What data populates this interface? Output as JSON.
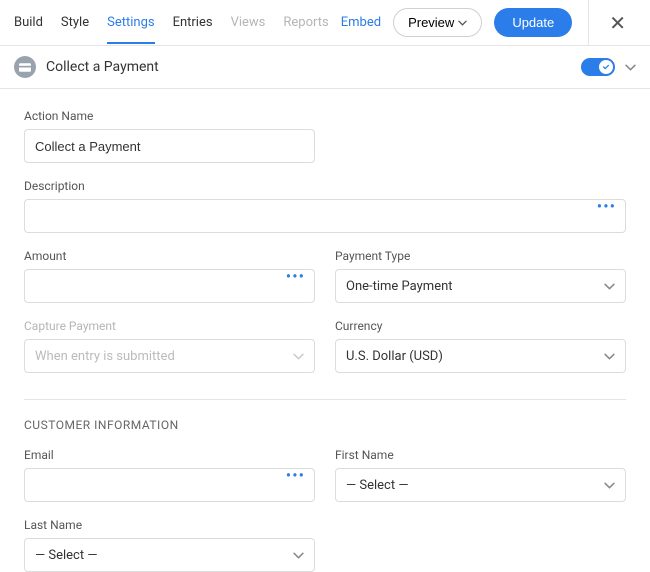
{
  "tabs": {
    "build": "Build",
    "style": "Style",
    "settings": "Settings",
    "entries": "Entries",
    "views": "Views",
    "reports": "Reports"
  },
  "header": {
    "embed": "Embed",
    "preview": "Preview",
    "update": "Update"
  },
  "panel": {
    "title": "Collect a Payment"
  },
  "form": {
    "action_name_label": "Action Name",
    "action_name_value": "Collect a Payment",
    "description_label": "Description",
    "description_value": "",
    "amount_label": "Amount",
    "amount_value": "",
    "payment_type_label": "Payment Type",
    "payment_type_value": "One-time Payment",
    "capture_payment_label": "Capture Payment",
    "capture_payment_placeholder": "When entry is submitted",
    "currency_label": "Currency",
    "currency_value": "U.S. Dollar (USD)"
  },
  "customer": {
    "heading": "CUSTOMER INFORMATION",
    "email_label": "Email",
    "email_value": "",
    "first_name_label": "First Name",
    "first_name_value": "— Select —",
    "last_name_label": "Last Name",
    "last_name_value": "— Select —"
  }
}
